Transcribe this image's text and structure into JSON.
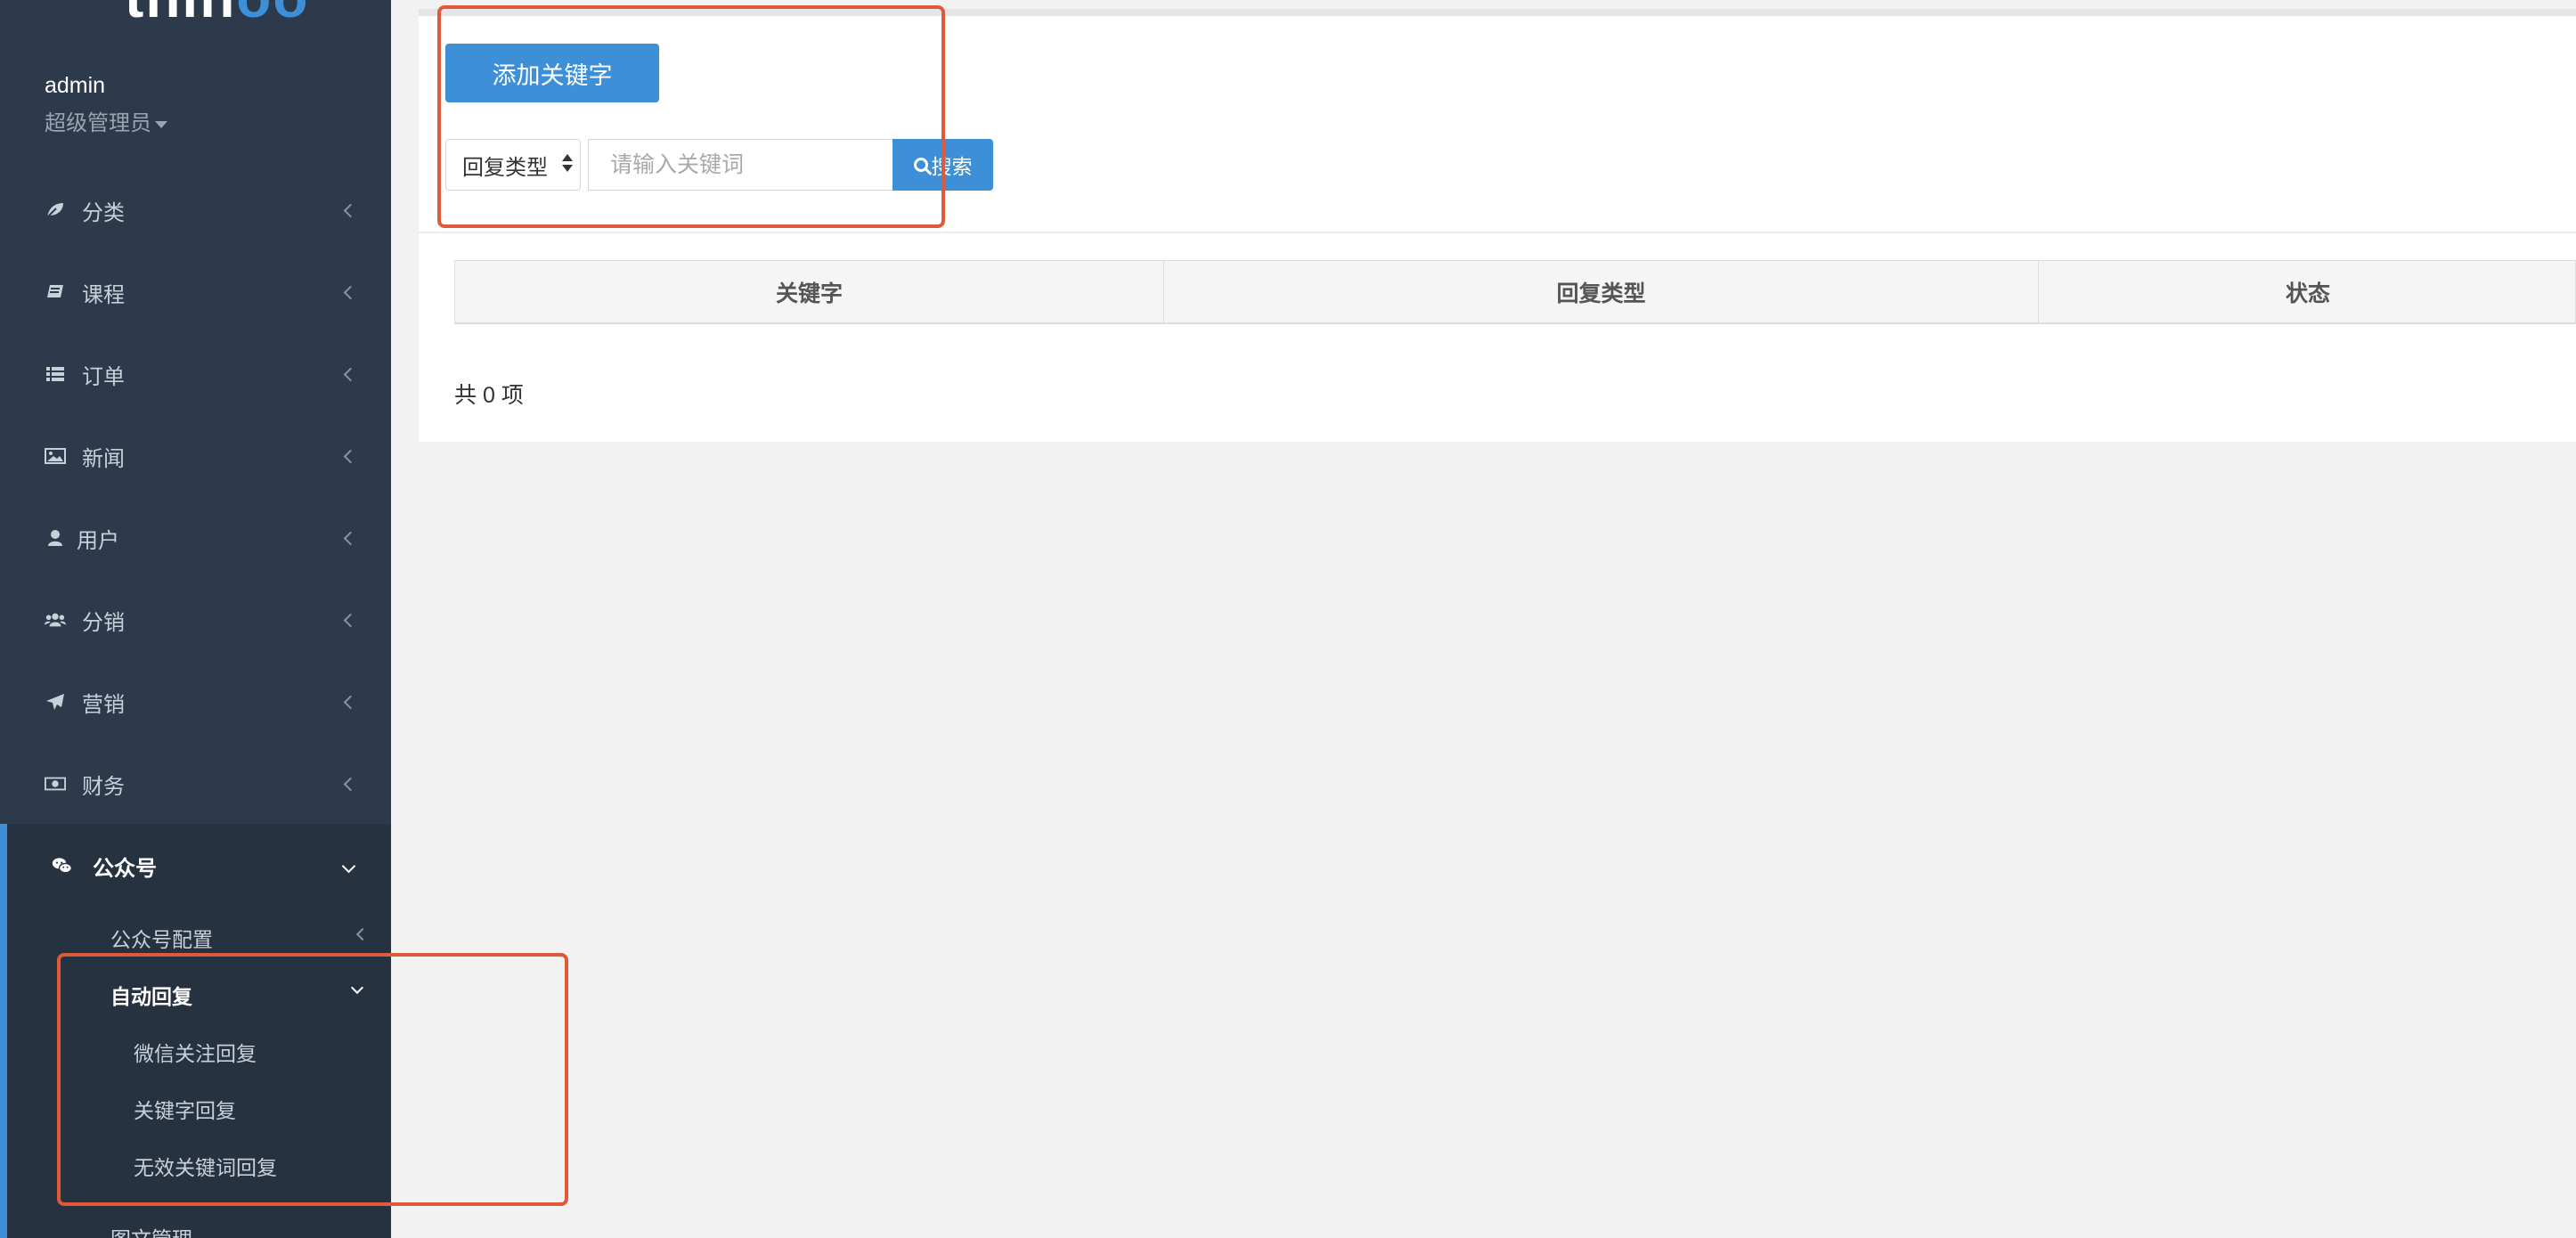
{
  "app": {
    "logo_main": "thin",
    "logo_accent": "oo"
  },
  "user": {
    "name": "admin",
    "role": "超级管理员"
  },
  "sidebar": {
    "items": [
      {
        "label": "分类",
        "icon": "leaf-icon"
      },
      {
        "label": "课程",
        "icon": "book-icon"
      },
      {
        "label": "订单",
        "icon": "list-icon"
      },
      {
        "label": "新闻",
        "icon": "image-icon"
      },
      {
        "label": "用户",
        "icon": "user-icon"
      },
      {
        "label": "分销",
        "icon": "users-icon"
      },
      {
        "label": "营销",
        "icon": "paper-plane-icon"
      },
      {
        "label": "财务",
        "icon": "money-icon"
      }
    ],
    "open_section": {
      "label": "公众号",
      "icon": "wechat-icon",
      "sub": [
        {
          "label": "公众号配置"
        },
        {
          "label": "自动回复",
          "children": [
            {
              "label": "微信关注回复"
            },
            {
              "label": "关键字回复"
            },
            {
              "label": "无效关键词回复"
            }
          ]
        },
        {
          "label": "图文管理"
        }
      ]
    }
  },
  "toolbar": {
    "add_label": "添加关键字",
    "select_value": "回复类型",
    "search_placeholder": "请输入关键词",
    "search_label": "搜索"
  },
  "table": {
    "headers": [
      "关键字",
      "回复类型",
      "状态"
    ]
  },
  "pagination": {
    "total_text": "共 0 项"
  },
  "colors": {
    "accent": "#3d8fd8",
    "sidebar": "#2d3a4b",
    "highlight": "#e05a3a"
  }
}
